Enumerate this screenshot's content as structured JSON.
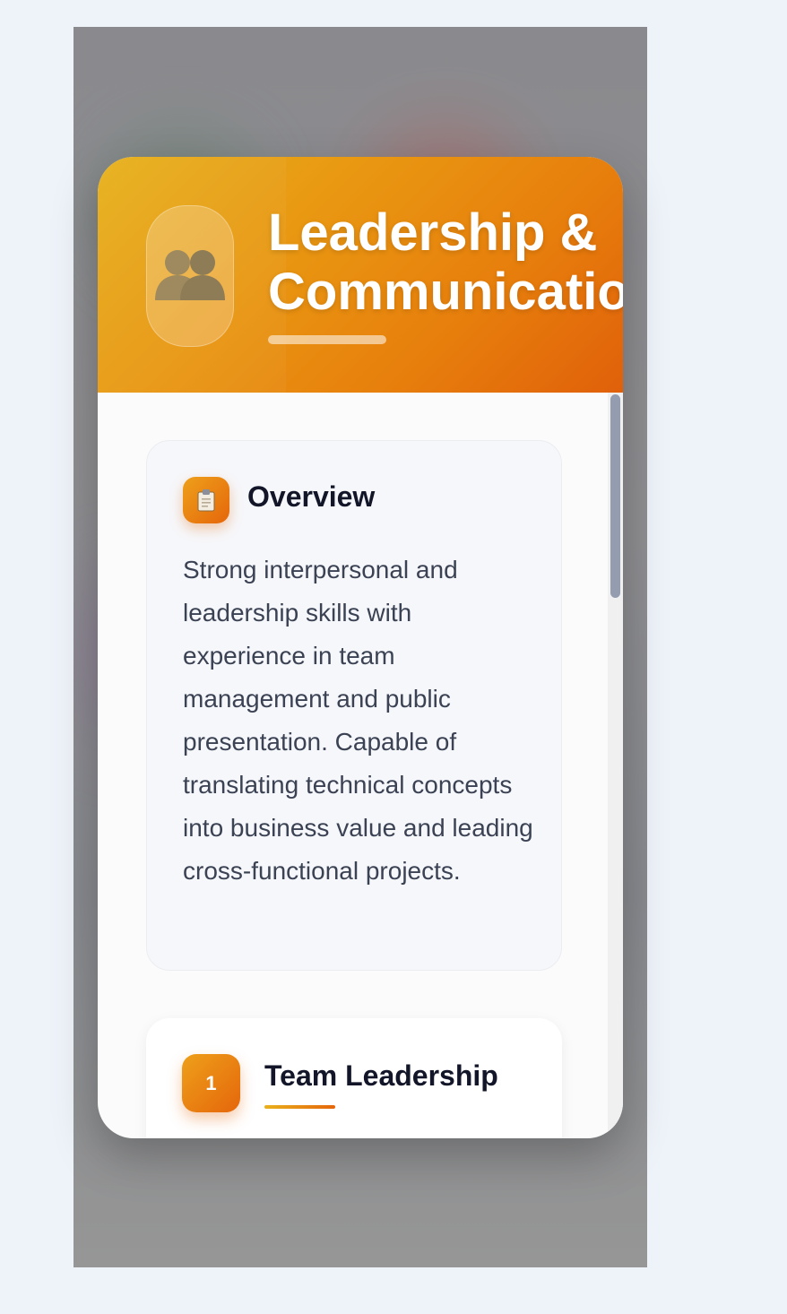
{
  "modal": {
    "header": {
      "icon": "people-icon",
      "title_line1": "Leadership &",
      "title_line2": "Communication"
    },
    "overview": {
      "icon": "clipboard-icon",
      "title": "Overview",
      "text": "Strong interpersonal and leadership skills with experience in team management and public presentation. Capable of translating technical concepts into business value and leading cross-functional projects."
    },
    "skills": [
      {
        "number": "1",
        "title": "Team Leadership"
      }
    ]
  },
  "colors": {
    "accent_start": "#e7b11c",
    "accent_end": "#e0600a",
    "scrollbar": "#949cb0"
  }
}
